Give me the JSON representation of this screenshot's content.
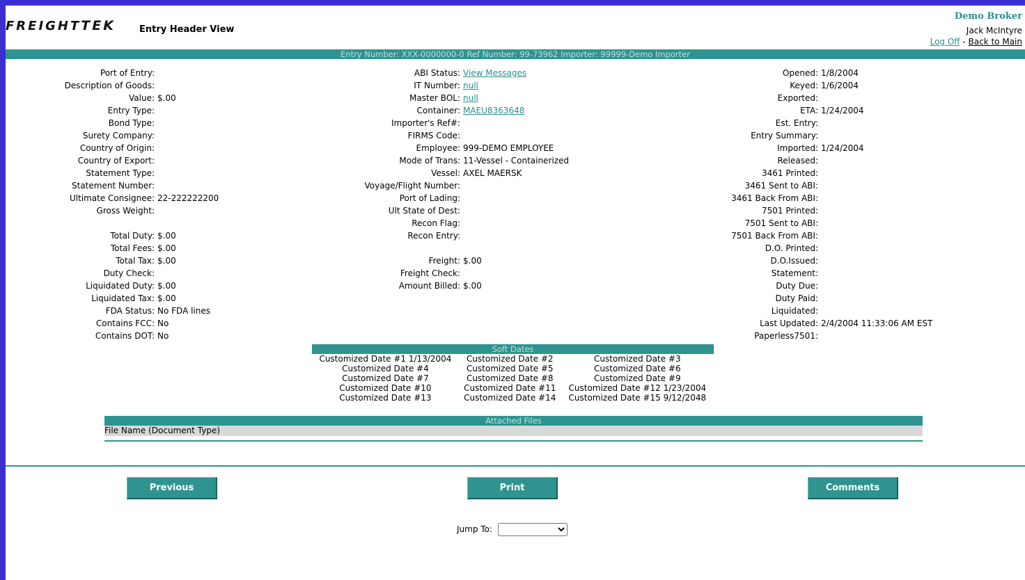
{
  "header": {
    "logo_text_a": "FREIGHT",
    "logo_text_b": "EK",
    "page_title": "Entry Header View",
    "broker": "Demo Broker",
    "user": "Jack McIntyre",
    "logoff": "Log Off",
    "separator": " - ",
    "back": "Back to Main",
    "entry_bar": "Entry Number: XXX-0000000-0   Ref Number: 99-73962   Importer: 99999-Demo Importer"
  },
  "col1": [
    {
      "label": "Port of Entry:",
      "value": ""
    },
    {
      "label": "Description of Goods:",
      "value": ""
    },
    {
      "label": "Value:",
      "value": "$.00"
    },
    {
      "label": "Entry Type:",
      "value": ""
    },
    {
      "label": "Bond Type:",
      "value": ""
    },
    {
      "label": "Surety Company:",
      "value": ""
    },
    {
      "label": "Country of Origin:",
      "value": ""
    },
    {
      "label": "Country of Export:",
      "value": ""
    },
    {
      "label": "Statement Type:",
      "value": ""
    },
    {
      "label": "Statement Number:",
      "value": ""
    },
    {
      "label": "Ultimate Consignee:",
      "value": "22-222222200"
    },
    {
      "label": "Gross Weight:",
      "value": ""
    },
    {
      "label": "",
      "value": ""
    },
    {
      "label": "Total Duty:",
      "value": "$.00"
    },
    {
      "label": "Total Fees:",
      "value": "$.00"
    },
    {
      "label": "Total Tax:",
      "value": "$.00"
    },
    {
      "label": "Duty Check:",
      "value": ""
    },
    {
      "label": "Liquidated Duty:",
      "value": "$.00"
    },
    {
      "label": "Liquidated Tax:",
      "value": "$.00"
    },
    {
      "label": "FDA Status:",
      "value": "No FDA lines"
    },
    {
      "label": "Contains FCC:",
      "value": "No"
    },
    {
      "label": "Contains DOT:",
      "value": "No"
    }
  ],
  "col2": [
    {
      "label": "ABI Status:",
      "value": "View Messages",
      "link": true
    },
    {
      "label": "IT Number:",
      "value": "null",
      "link": true
    },
    {
      "label": "Master BOL:",
      "value": "null",
      "link": true
    },
    {
      "label": "Container:",
      "value": "MAEU8363648",
      "link": true
    },
    {
      "label": "Importer's Ref#:",
      "value": ""
    },
    {
      "label": "FIRMS Code:",
      "value": ""
    },
    {
      "label": "Employee:",
      "value": "999-DEMO EMPLOYEE"
    },
    {
      "label": "Mode of Trans:",
      "value": "11-Vessel - Containerized"
    },
    {
      "label": "Vessel:",
      "value": "AXEL MAERSK"
    },
    {
      "label": "Voyage/Flight Number:",
      "value": ""
    },
    {
      "label": "Port of Lading:",
      "value": ""
    },
    {
      "label": "Ult State of Dest:",
      "value": ""
    },
    {
      "label": "Recon Flag:",
      "value": ""
    },
    {
      "label": "Recon Entry:",
      "value": ""
    },
    {
      "label": "",
      "value": ""
    },
    {
      "label": "Freight:",
      "value": "$.00"
    },
    {
      "label": "Freight Check:",
      "value": ""
    },
    {
      "label": "Amount Billed:",
      "value": "$.00"
    }
  ],
  "col3": [
    {
      "label": "Opened:",
      "value": "1/8/2004"
    },
    {
      "label": "Keyed:",
      "value": "1/6/2004"
    },
    {
      "label": "Exported:",
      "value": ""
    },
    {
      "label": "ETA:",
      "value": "1/24/2004"
    },
    {
      "label": "Est. Entry:",
      "value": ""
    },
    {
      "label": "Entry Summary:",
      "value": ""
    },
    {
      "label": "Imported:",
      "value": "1/24/2004"
    },
    {
      "label": "Released:",
      "value": ""
    },
    {
      "label": "3461 Printed:",
      "value": ""
    },
    {
      "label": "3461 Sent to ABI:",
      "value": ""
    },
    {
      "label": "3461 Back From ABI:",
      "value": ""
    },
    {
      "label": "7501 Printed:",
      "value": ""
    },
    {
      "label": "7501 Sent to ABI:",
      "value": ""
    },
    {
      "label": "7501 Back From ABI:",
      "value": ""
    },
    {
      "label": "D.O. Printed:",
      "value": ""
    },
    {
      "label": "D.O.Issued:",
      "value": ""
    },
    {
      "label": "Statement:",
      "value": ""
    },
    {
      "label": "Duty Due:",
      "value": ""
    },
    {
      "label": "Duty Paid:",
      "value": ""
    },
    {
      "label": "Liquidated:",
      "value": ""
    },
    {
      "label": "Last Updated:",
      "value": "2/4/2004 11:33:06 AM EST"
    },
    {
      "label": "Paperless7501:",
      "value": ""
    }
  ],
  "soft_dates": {
    "title": "Soft Dates",
    "rows": [
      [
        "Customized Date #1 1/13/2004",
        "Customized Date #2",
        "Customized Date #3"
      ],
      [
        "Customized Date #4",
        "Customized Date #5",
        "Customized Date #6"
      ],
      [
        "Customized Date #7",
        "Customized Date #8",
        "Customized Date #9"
      ],
      [
        "Customized Date #10",
        "Customized Date #11",
        "Customized Date #12 1/23/2004"
      ],
      [
        "Customized Date #13",
        "Customized Date #14",
        "Customized Date #15 9/12/2048"
      ]
    ]
  },
  "files": {
    "title": "Attached Files",
    "column": "File Name (Document Type)"
  },
  "buttons": {
    "previous": "Previous",
    "print": "Print",
    "comments": "Comments"
  },
  "jump": {
    "label": "Jump To:",
    "selected": ""
  },
  "colors": {
    "teal": "#2f948f",
    "frame": "#3a2fd2",
    "link": "#2a8f8f"
  }
}
